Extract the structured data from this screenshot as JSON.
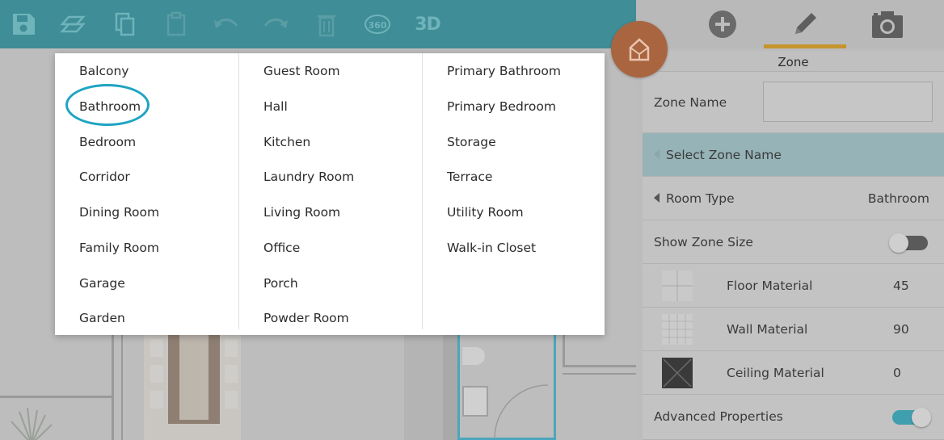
{
  "toolbar": {
    "buttons": [
      {
        "name": "save-icon"
      },
      {
        "name": "layers-icon"
      },
      {
        "name": "copy-icon"
      },
      {
        "name": "paste-icon"
      },
      {
        "name": "undo-icon"
      },
      {
        "name": "redo-icon"
      },
      {
        "name": "delete-icon"
      },
      {
        "name": "view-360-icon",
        "label": "360"
      },
      {
        "name": "view-3d-button",
        "label": "3D"
      }
    ]
  },
  "panel": {
    "tabs": [
      {
        "name": "add-icon",
        "active": false
      },
      {
        "name": "pencil-icon",
        "active": true
      },
      {
        "name": "camera-icon",
        "active": false
      }
    ],
    "header": "Zone",
    "zone_name_label": "Zone Name",
    "zone_name_value": "",
    "select_zone_name": "Select Zone Name",
    "room_type_label": "Room Type",
    "room_type_value": "Bathroom",
    "show_zone_size_label": "Show Zone Size",
    "show_zone_size_on": false,
    "materials": [
      {
        "label": "Floor Material",
        "value": "45",
        "swatch": "floor-tile-swatch"
      },
      {
        "label": "Wall Material",
        "value": "90",
        "swatch": "wall-tile-swatch"
      },
      {
        "label": "Ceiling Material",
        "value": "0",
        "swatch": "ceiling-swatch"
      }
    ],
    "advanced_properties_label": "Advanced Properties",
    "advanced_properties_on": true
  },
  "room_menu": {
    "selected": "Bathroom",
    "columns": [
      [
        "Balcony",
        "Bathroom",
        "Bedroom",
        "Corridor",
        "Dining Room",
        "Family Room",
        "Garage",
        "Garden"
      ],
      [
        "Guest Room",
        "Hall",
        "Kitchen",
        "Laundry Room",
        "Living Room",
        "Office",
        "Porch",
        "Powder Room"
      ],
      [
        "Primary Bathroom",
        "Primary Bedroom",
        "Storage",
        "Terrace",
        "Utility Room",
        "Walk-in Closet"
      ]
    ]
  },
  "colors": {
    "toolbar_bg": "#3f8d96",
    "fab": "#a9653f",
    "active_tab_underline": "#c5942c",
    "selection_ring": "#1ea4c2",
    "toggle_on": "#3f9fae"
  }
}
